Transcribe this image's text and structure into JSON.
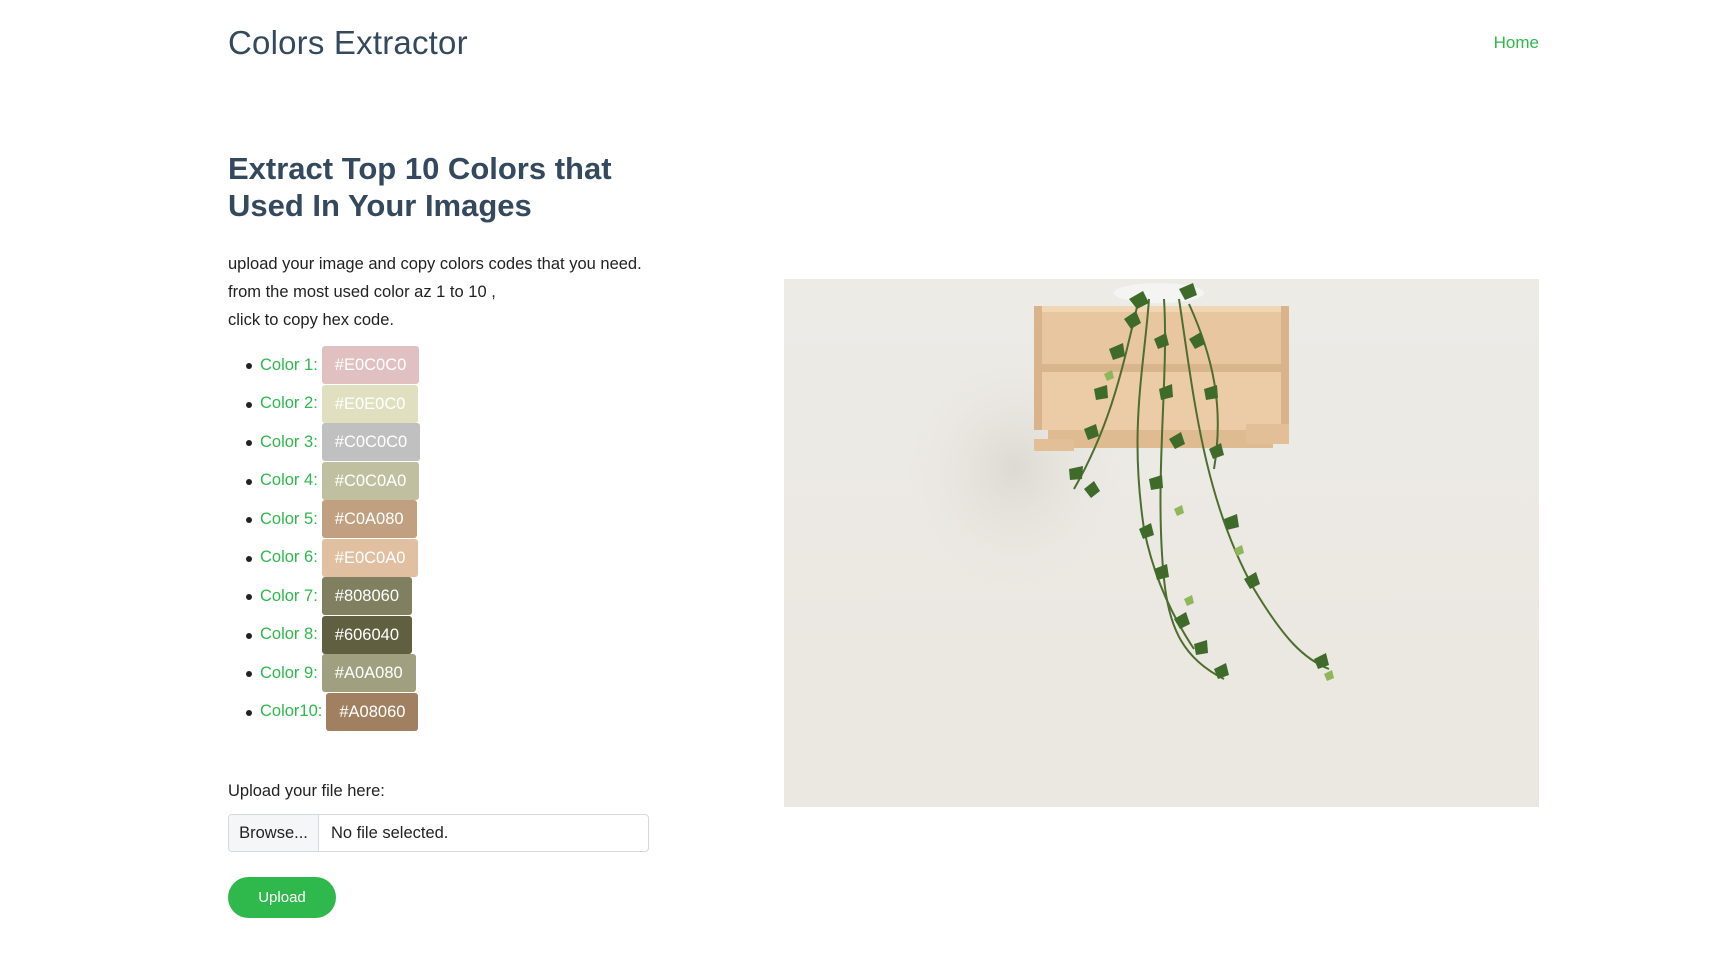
{
  "navbar": {
    "brand": "Colors Extractor",
    "home_link": "Home"
  },
  "main": {
    "headline": "Extract Top 10 Colors that Used In Your Images",
    "intro_lines": [
      "upload your image and copy colors codes that you need.",
      "from the most used color az 1 to 10 ,",
      "click to copy hex code."
    ],
    "colors": [
      {
        "label": "Color 1:",
        "hex": "#E0C0C0"
      },
      {
        "label": "Color 2:",
        "hex": "#E0E0C0"
      },
      {
        "label": "Color 3:",
        "hex": "#C0C0C0"
      },
      {
        "label": "Color 4:",
        "hex": "#C0C0A0"
      },
      {
        "label": "Color 5:",
        "hex": "#C0A080"
      },
      {
        "label": "Color 6:",
        "hex": "#E0C0A0"
      },
      {
        "label": "Color 7:",
        "hex": "#808060"
      },
      {
        "label": "Color 8:",
        "hex": "#606040"
      },
      {
        "label": "Color 9:",
        "hex": "#A0A080"
      },
      {
        "label": "Color10:",
        "hex": "#A08060"
      }
    ]
  },
  "upload": {
    "label": "Upload your file here:",
    "browse_label": "Browse...",
    "file_status": "No file selected.",
    "submit_label": "Upload"
  },
  "theme": {
    "accent": "#2fb84c",
    "heading": "#34495e"
  },
  "preview_image": {
    "icon": "plant-crate-photo"
  }
}
